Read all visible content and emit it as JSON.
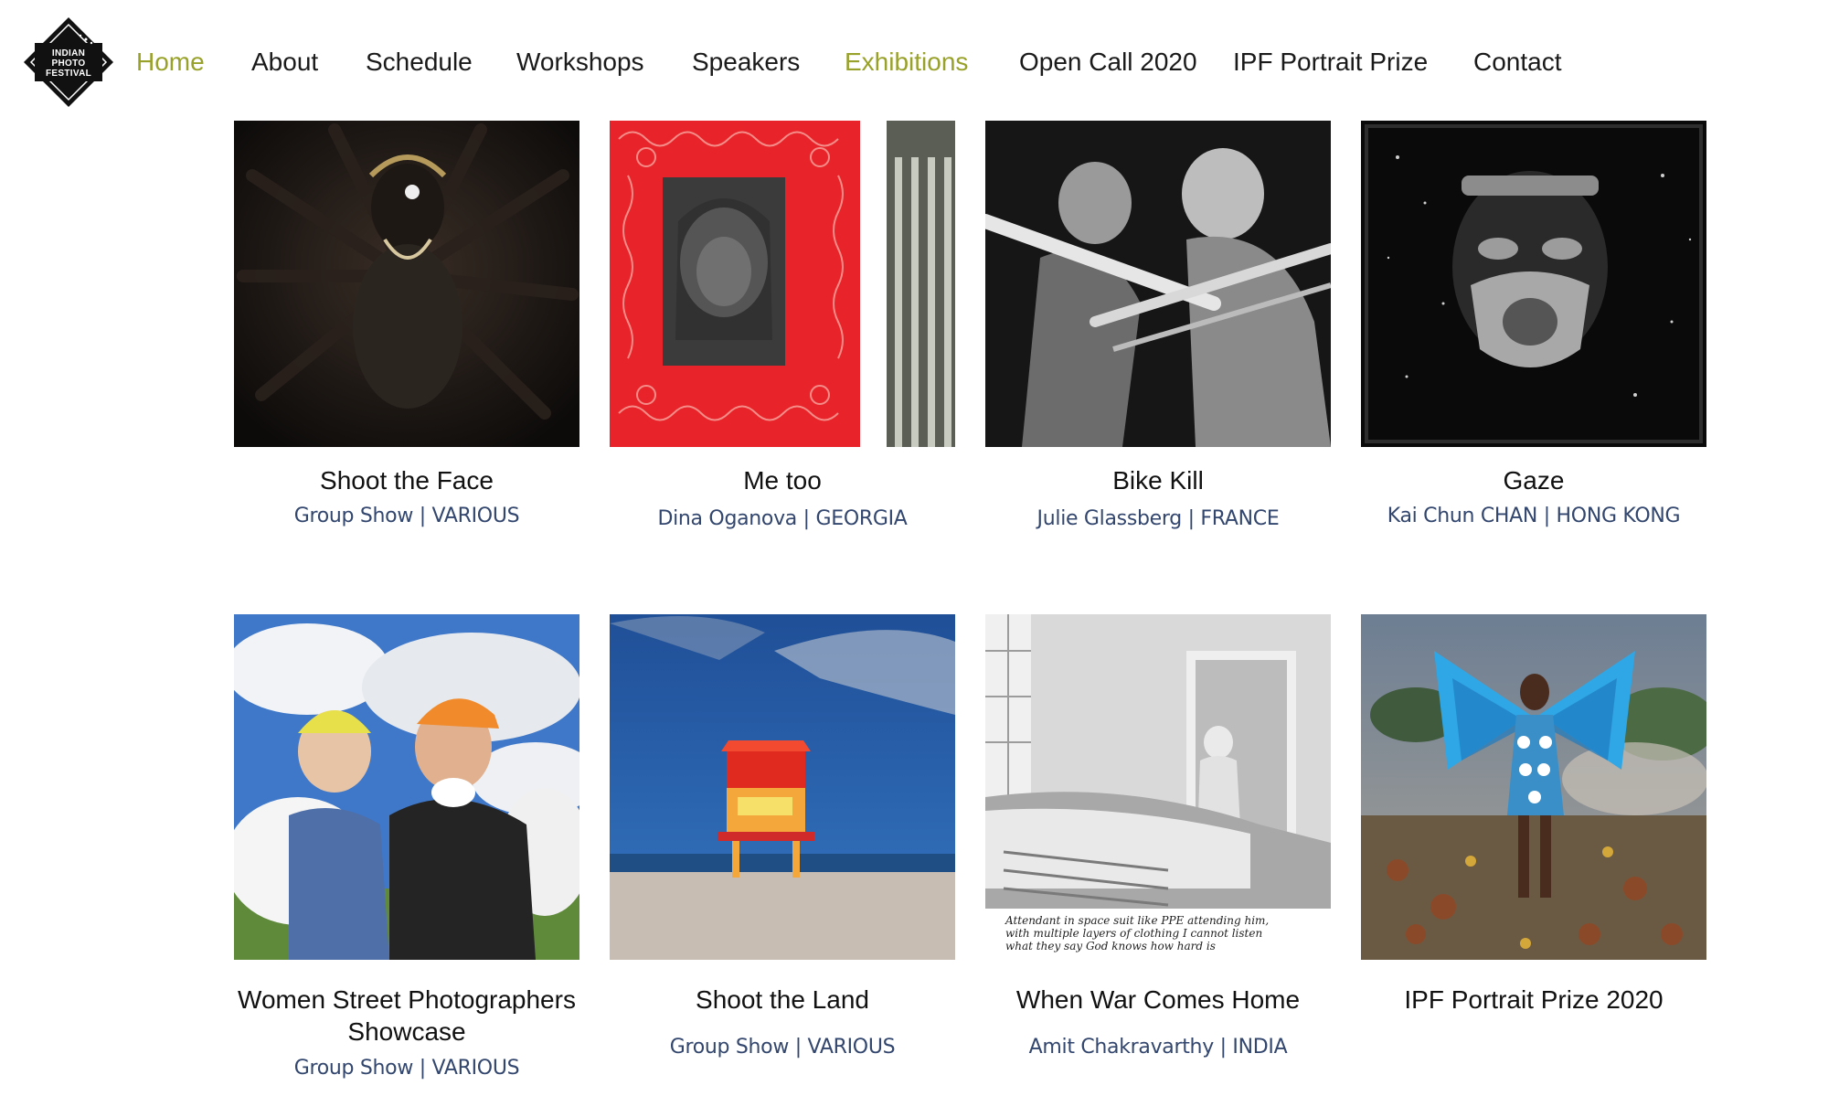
{
  "logo": {
    "line1": "INDIAN",
    "line2": "PHOTO",
    "line3": "FESTIVAL",
    "icon": "ipf-logo-icon"
  },
  "nav": {
    "items": [
      {
        "label": "Home",
        "active": true
      },
      {
        "label": "About",
        "active": false
      },
      {
        "label": "Schedule",
        "active": false
      },
      {
        "label": "Workshops",
        "active": false
      },
      {
        "label": "Speakers",
        "active": false
      },
      {
        "label": "Exhibitions",
        "active": true
      },
      {
        "label": "Open Call 2020",
        "active": false
      },
      {
        "label": "IPF Portrait Prize",
        "active": false
      },
      {
        "label": "Contact",
        "active": false
      }
    ]
  },
  "colors": {
    "accent": "#98a12a",
    "subtitle": "#32466e"
  },
  "exhibitions": [
    {
      "title": "Shoot the Face",
      "artist": "Group Show",
      "country": "VARIOUS",
      "subtitle": "Group Show | VARIOUS"
    },
    {
      "title": "Me too",
      "artist": "Dina Oganova",
      "country": "GEORGIA",
      "subtitle": "Dina Oganova | GEORGIA"
    },
    {
      "title": "Bike Kill",
      "artist": "Julie Glassberg",
      "country": "FRANCE",
      "subtitle": "Julie Glassberg | FRANCE"
    },
    {
      "title": "Gaze",
      "artist": "Kai Chun CHAN",
      "country": "HONG KONG",
      "subtitle": "Kai Chun CHAN | HONG KONG"
    },
    {
      "title": "Women Street Photographers",
      "title_line2": "Showcase",
      "artist": "Group Show",
      "country": "VARIOUS",
      "subtitle": "Group Show | VARIOUS"
    },
    {
      "title": "Shoot the Land",
      "artist": "Group Show",
      "country": "VARIOUS",
      "subtitle": "Group Show | VARIOUS"
    },
    {
      "title": "When War Comes Home",
      "artist": "Amit Chakravarthy",
      "country": "INDIA",
      "subtitle": "Amit Chakravarthy | INDIA"
    },
    {
      "title": "IPF Portrait Prize 2020"
    }
  ],
  "handwritten_caption": {
    "line1": "Attendant in space suit like PPE attending him,",
    "line2": "with multiple layers of clothing I cannot listen",
    "line3": "what they say    God knows how hard is"
  }
}
